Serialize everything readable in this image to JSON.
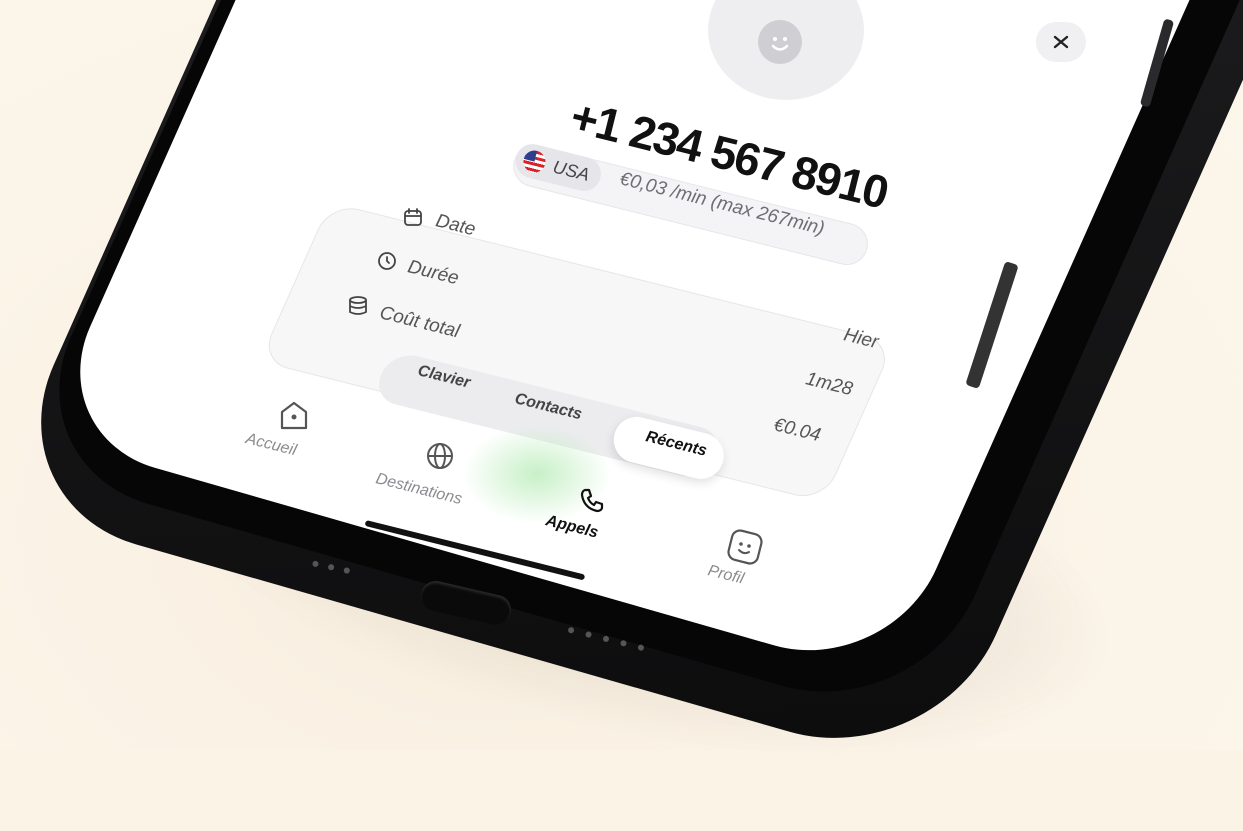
{
  "call": {
    "phone_number": "+1 234 567 8910",
    "country": "USA",
    "rate": "€0,03 /min (max 267min)"
  },
  "details": {
    "rows": [
      {
        "label": "Date",
        "value": "Hier",
        "icon": "calendar-icon"
      },
      {
        "label": "Durée",
        "value": "1m28",
        "icon": "clock-icon"
      },
      {
        "label": "Coût total",
        "value": "€0.04",
        "icon": "coins-icon"
      }
    ]
  },
  "tabs": {
    "items": [
      "Clavier",
      "Contacts",
      "Récents"
    ],
    "selected": "Récents"
  },
  "nav": {
    "items": [
      {
        "label": "Accueil",
        "icon": "home-icon"
      },
      {
        "label": "Destinations",
        "icon": "globe-icon"
      },
      {
        "label": "Appels",
        "icon": "phone-icon",
        "active": true
      },
      {
        "label": "Profil",
        "icon": "smiley-icon"
      }
    ]
  },
  "colors": {
    "background": "#fbf3e6",
    "phone_frame": "#1b1b1d",
    "screen": "#ffffff",
    "accent_green": "#c9f0c9"
  }
}
